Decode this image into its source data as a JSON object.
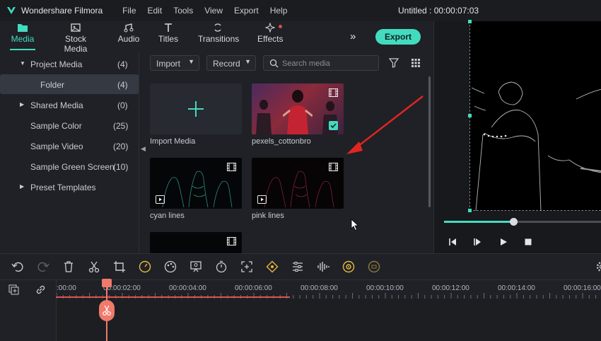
{
  "app": {
    "name": "Wondershare Filmora",
    "menu": [
      "File",
      "Edit",
      "Tools",
      "View",
      "Export",
      "Help"
    ],
    "window_title": "Untitled : 00:00:07:03",
    "accent": "#43dbc0"
  },
  "tabs": [
    {
      "label": "Media",
      "icon": "media-folder-icon",
      "active": true
    },
    {
      "label": "Stock Media",
      "icon": "stock-media-icon"
    },
    {
      "label": "Audio",
      "icon": "music-note-icon"
    },
    {
      "label": "Titles",
      "icon": "titles-T-icon"
    },
    {
      "label": "Transitions",
      "icon": "transitions-icon"
    },
    {
      "label": "Effects",
      "icon": "effects-icon",
      "badge": "red-dot"
    }
  ],
  "export_label": "Export",
  "left_panel": {
    "items": [
      {
        "label": "Project Media",
        "count": "(4)",
        "expandable": true
      },
      {
        "label": "Folder",
        "count": "(4)",
        "selected": true
      },
      {
        "label": "Shared Media",
        "count": "(0)",
        "expandable": true
      },
      {
        "label": "Sample Color",
        "count": "(25)"
      },
      {
        "label": "Sample Video",
        "count": "(20)"
      },
      {
        "label": "Sample Green Screen",
        "count": "(10)"
      },
      {
        "label": "Preset Templates",
        "count": "",
        "expandable": true
      }
    ]
  },
  "media": {
    "import_label": "Import",
    "record_label": "Record",
    "search_placeholder": "Search media",
    "items": [
      {
        "label": "Import Media",
        "type": "import"
      },
      {
        "label": "pexels_cottonbro",
        "type": "video",
        "checked": true
      },
      {
        "label": "cyan lines",
        "type": "video"
      },
      {
        "label": "pink lines",
        "type": "video"
      }
    ]
  },
  "preview": {
    "progress": 0.44
  },
  "toolbar_icons": [
    "undo-icon",
    "redo-icon",
    "delete-icon",
    "cut-icon",
    "crop-icon",
    "speed-icon",
    "color-icon",
    "green-screen-icon",
    "timer-icon",
    "fit-icon",
    "keyframe-icon",
    "adjust-icon",
    "audio-icon",
    "motion-track-icon",
    "auto-reframe-icon"
  ],
  "ruler": [
    ":00:00",
    "00:00:02:00",
    "00:00:04:00",
    "00:00:06:00",
    "00:00:08:00",
    "00:00:10:00",
    "00:00:12:00",
    "00:00:14:00",
    "00:00:16:00"
  ]
}
